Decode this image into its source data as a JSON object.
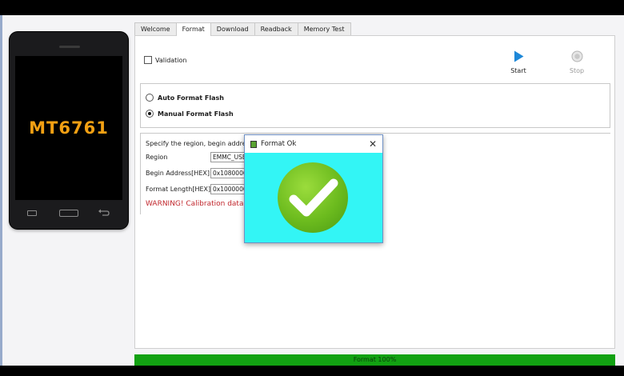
{
  "phone": {
    "chip": "MT6761"
  },
  "tabs": [
    {
      "label": "Welcome",
      "active": false
    },
    {
      "label": "Format",
      "active": true
    },
    {
      "label": "Download",
      "active": false
    },
    {
      "label": "Readback",
      "active": false
    },
    {
      "label": "Memory Test",
      "active": false
    }
  ],
  "options": {
    "validation_label": "Validation",
    "validation_checked": false
  },
  "toolbar": {
    "start_label": "Start",
    "stop_label": "Stop"
  },
  "format_mode": {
    "auto_label": "Auto Format Flash",
    "manual_label": "Manual Format Flash",
    "selected": "manual"
  },
  "region_section": {
    "description": "Specify the region, begin address",
    "region_label": "Region",
    "region_value": "EMMC_USE",
    "begin_label": "Begin Address[HEX]:",
    "begin_value": "0x1080000",
    "length_label": "Format Length[HEX]:",
    "length_value": "0x1000000",
    "warning": "WARNING! Calibration data i"
  },
  "dialog": {
    "title": "Format Ok",
    "close": "✕"
  },
  "status": {
    "text": "Format 100%",
    "progress": 1.0,
    "color": "#12a112"
  }
}
